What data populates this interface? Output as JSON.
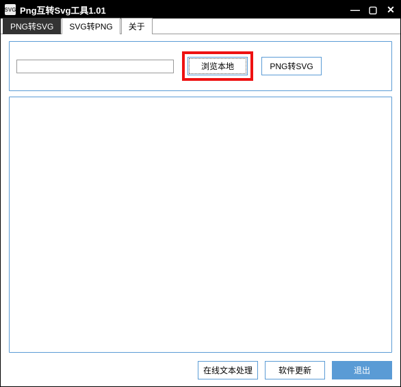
{
  "window": {
    "title": "Png互转Svg工具1.01",
    "icon_label": "SVG"
  },
  "tabs": {
    "png_to_svg": "PNG转SVG",
    "svg_to_png": "SVG转PNG",
    "about": "关于"
  },
  "input_row": {
    "path_value": "",
    "browse_label": "浏览本地",
    "convert_label": "PNG转SVG"
  },
  "footer": {
    "online_text": "在线文本处理",
    "update": "软件更新",
    "exit": "退出"
  }
}
